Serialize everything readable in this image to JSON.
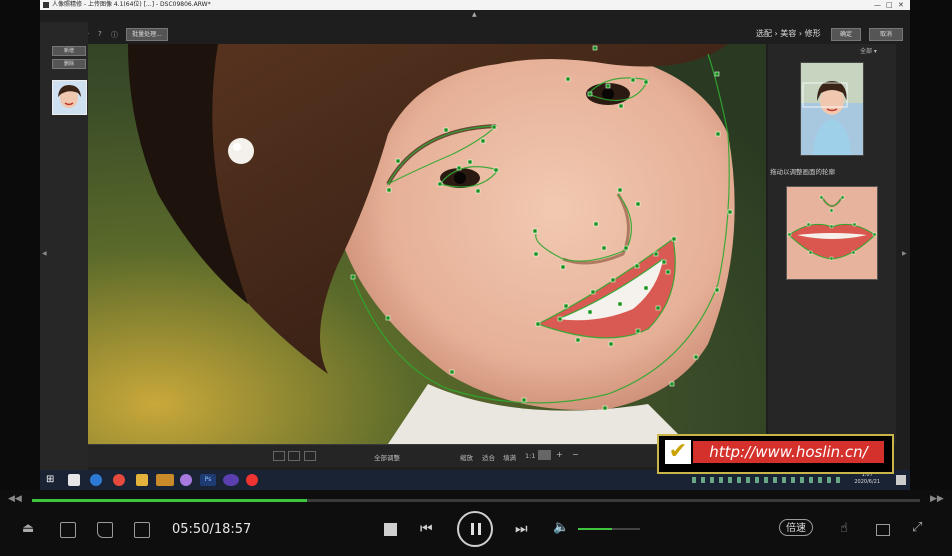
{
  "window": {
    "title": "人像照精修 - 上传图像 4.1(64位) [...] - DSC09806.ARW*"
  },
  "left_panel": {
    "buttons": [
      "新增",
      "删除"
    ]
  },
  "toolbar": {
    "batch_label": "批量处理...",
    "breadcrumb": "选配 › 美容 › 修形",
    "confirm_label": "确定",
    "cancel_label": "取消"
  },
  "right_panel": {
    "select_label": "全部",
    "hint_label": "拖动以调整画面的轮廓"
  },
  "app_bottom": {
    "center_text": "全部调整",
    "zoom_labels": [
      "缩放",
      "适合",
      "填满"
    ],
    "zoom_value": "1:1",
    "plus": "+",
    "minus": "−"
  },
  "taskbar": {
    "time": "1:07",
    "date": "2020/6/21"
  },
  "watermark": {
    "url": "http://www.hoslin.cn/"
  },
  "player": {
    "current_time": "05:50",
    "total_time": "18:57",
    "time_display": "05:50/18:57",
    "progress": 0.31,
    "volume": 0.55,
    "speed_label": "倍速"
  },
  "colors": {
    "accent": "#3ec43e",
    "watermark_red": "#d4302c",
    "watermark_border": "#c9b54a"
  }
}
